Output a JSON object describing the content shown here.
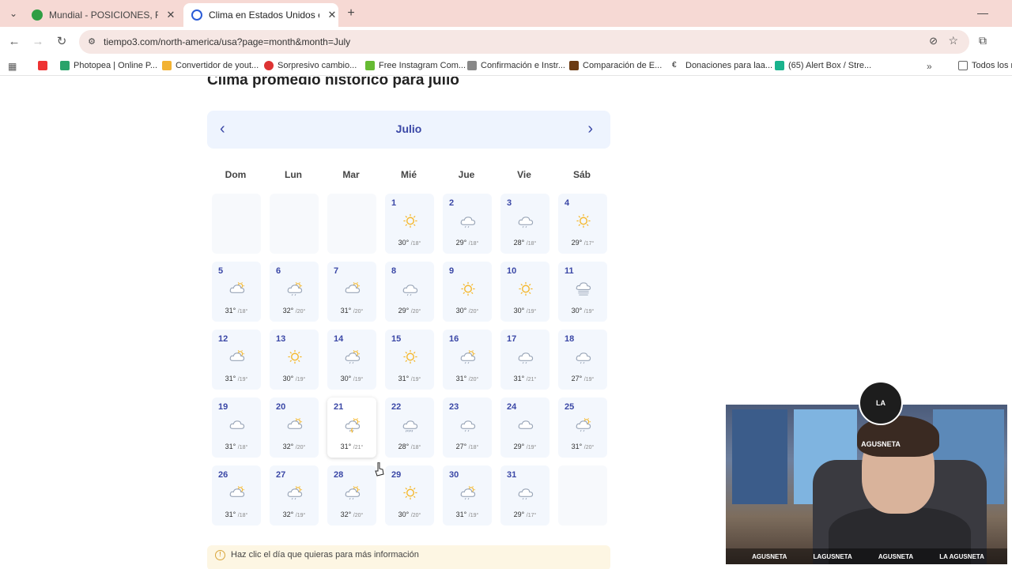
{
  "browser": {
    "tabs": [
      {
        "title": "Mundial - POSICIONES, RESULT",
        "favicon_color": "#2f9e44"
      },
      {
        "title": "Clima en Estados Unidos en julio",
        "favicon_color": "#2a5bd7"
      }
    ],
    "url": "tiempo3.com/north-america/usa?page=month&month=July",
    "bookmarks": [
      {
        "label": "",
        "color": "#e33"
      },
      {
        "label": "Photopea | Online P...",
        "color": "#29a36a"
      },
      {
        "label": "Convertidor de yout...",
        "color": "#f2b233"
      },
      {
        "label": "Sorpresivo cambio...",
        "color": "#d33"
      },
      {
        "label": "Free Instagram Com...",
        "color": "#6b3"
      },
      {
        "label": "Confirmación e Instr...",
        "color": "#888"
      },
      {
        "label": "Comparación de E...",
        "color": "#6b3a12"
      },
      {
        "label": "Donaciones para laa...",
        "color": "#222"
      },
      {
        "label": "(65) Alert Box / Stre...",
        "color": "#19b38d"
      },
      {
        "label": "Todos los m",
        "color": "#666"
      }
    ]
  },
  "page": {
    "heading": "Clima promedio histórico para julio",
    "month": "Julio",
    "weekdays": [
      "Dom",
      "Lun",
      "Mar",
      "Mié",
      "Jue",
      "Vie",
      "Sáb"
    ],
    "days": [
      {
        "day": "1",
        "max": "30°",
        "min": "/18°",
        "icon": "sun"
      },
      {
        "day": "2",
        "max": "29°",
        "min": "/18°",
        "icon": "cloud-rain"
      },
      {
        "day": "3",
        "max": "28°",
        "min": "/18°",
        "icon": "cloud-rain"
      },
      {
        "day": "4",
        "max": "29°",
        "min": "/17°",
        "icon": "sun"
      },
      {
        "day": "5",
        "max": "31°",
        "min": "/18°",
        "icon": "partly-cloudy"
      },
      {
        "day": "6",
        "max": "32°",
        "min": "/20°",
        "icon": "partly-cloudy-rain"
      },
      {
        "day": "7",
        "max": "31°",
        "min": "/20°",
        "icon": "partly-cloudy"
      },
      {
        "day": "8",
        "max": "29°",
        "min": "/20°",
        "icon": "cloud-rain"
      },
      {
        "day": "9",
        "max": "30°",
        "min": "/20°",
        "icon": "sun"
      },
      {
        "day": "10",
        "max": "30°",
        "min": "/19°",
        "icon": "sun"
      },
      {
        "day": "11",
        "max": "30°",
        "min": "/19°",
        "icon": "cloud-fog"
      },
      {
        "day": "12",
        "max": "31°",
        "min": "/19°",
        "icon": "partly-cloudy"
      },
      {
        "day": "13",
        "max": "30°",
        "min": "/19°",
        "icon": "sun"
      },
      {
        "day": "14",
        "max": "30°",
        "min": "/19°",
        "icon": "partly-cloudy-rain"
      },
      {
        "day": "15",
        "max": "31°",
        "min": "/19°",
        "icon": "sun"
      },
      {
        "day": "16",
        "max": "31°",
        "min": "/20°",
        "icon": "partly-cloudy-rain"
      },
      {
        "day": "17",
        "max": "31°",
        "min": "/21°",
        "icon": "cloud-rain"
      },
      {
        "day": "18",
        "max": "27°",
        "min": "/19°",
        "icon": "cloud-rain"
      },
      {
        "day": "19",
        "max": "31°",
        "min": "/18°",
        "icon": "cloud"
      },
      {
        "day": "20",
        "max": "32°",
        "min": "/20°",
        "icon": "partly-cloudy"
      },
      {
        "day": "21",
        "max": "31°",
        "min": "/21°",
        "icon": "thunderstorm"
      },
      {
        "day": "22",
        "max": "28°",
        "min": "/18°",
        "icon": "heavy-rain"
      },
      {
        "day": "23",
        "max": "27°",
        "min": "/18°",
        "icon": "cloud-rain"
      },
      {
        "day": "24",
        "max": "29°",
        "min": "/19°",
        "icon": "cloud"
      },
      {
        "day": "25",
        "max": "31°",
        "min": "/20°",
        "icon": "partly-cloudy-rain"
      },
      {
        "day": "26",
        "max": "31°",
        "min": "/18°",
        "icon": "partly-cloudy"
      },
      {
        "day": "27",
        "max": "32°",
        "min": "/19°",
        "icon": "partly-cloudy-rain"
      },
      {
        "day": "28",
        "max": "32°",
        "min": "/20°",
        "icon": "partly-cloudy-rain"
      },
      {
        "day": "29",
        "max": "30°",
        "min": "/20°",
        "icon": "sun"
      },
      {
        "day": "30",
        "max": "31°",
        "min": "/19°",
        "icon": "partly-cloudy-rain"
      },
      {
        "day": "31",
        "max": "29°",
        "min": "/17°",
        "icon": "cloud-rain"
      }
    ],
    "info_text": "Haz clic el día que quieras para más información"
  },
  "webcam": {
    "logo_text": "LA AGUSNETA",
    "social": [
      "AGUSNETA",
      "LAGUSNETA",
      "AGUSNETA",
      "LA AGUSNETA"
    ]
  },
  "colors": {
    "accent": "#3a47a6",
    "sun": "#f5b82e",
    "cloud": "#9aa6b8"
  }
}
